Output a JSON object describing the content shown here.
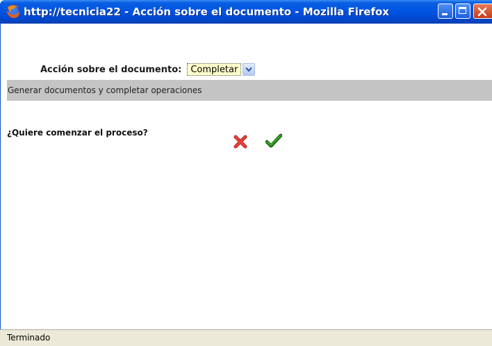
{
  "window": {
    "title": "http://tecnicia22 - Acción sobre el documento - Mozilla Firefox",
    "icon": "firefox-icon"
  },
  "form": {
    "action_label": "Acción sobre el documento:",
    "action_select": {
      "selected": "Completar"
    }
  },
  "description": {
    "text": "Generar documentos y completar operaciones"
  },
  "prompt": {
    "question": "¿Quiere comenzar el proceso?",
    "cancel_icon": "cross-icon",
    "confirm_icon": "checkmark-icon"
  },
  "status": {
    "text": "Terminado"
  },
  "colors": {
    "titlebar": "#0055e5",
    "description_bar": "#c4c4c4",
    "select_bg": "#ffffcc",
    "cancel": "#d8312a",
    "confirm": "#2a8a1e",
    "statusbar": "#ece9d8"
  }
}
